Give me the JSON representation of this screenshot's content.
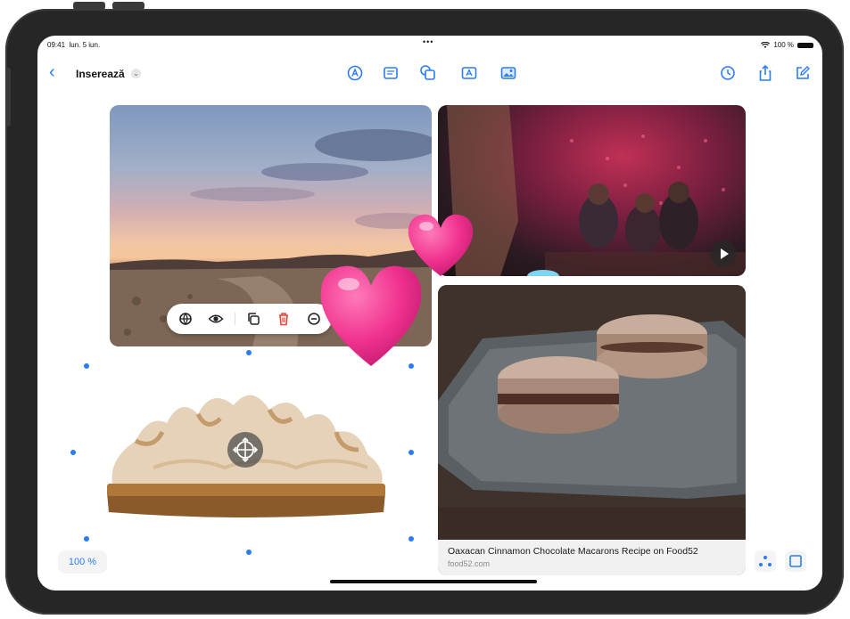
{
  "status_bar": {
    "time": "09:41",
    "date": "lun. 5 iun.",
    "dots": "•••",
    "battery_text": "100 %"
  },
  "toolbar": {
    "back_icon": "chevron-left-icon",
    "title": "Inserează",
    "title_menu_icon": "chevron-down-icon",
    "center_tools": [
      "pen-tool-icon",
      "sticky-note-icon",
      "shapes-icon",
      "text-box-icon",
      "media-icon"
    ],
    "right_tools": [
      "history-icon",
      "share-icon",
      "edit-icon"
    ],
    "accent_color": "#2b7cf2"
  },
  "canvas": {
    "photos": [
      {
        "name": "sunset-desert-photo"
      },
      {
        "name": "party-video-thumbnail",
        "play_icon": "play-icon"
      },
      {
        "name": "lemon-meringue-pie-cutout",
        "move_icon": "move-rotate-icon"
      }
    ],
    "stickers": [
      "heart-sticker-small",
      "heart-sticker-large"
    ],
    "context_menu": {
      "items": [
        "lookup-icon",
        "eye-icon",
        "duplicate-icon",
        "trash-icon",
        "more-icon"
      ],
      "delete_color": "#e5453a"
    },
    "link_card": {
      "title": "Oaxacan Cinnamon Chocolate Macarons Recipe on Food52",
      "domain": "food52.com"
    }
  },
  "bottom_bar": {
    "zoom": "100 %",
    "right_tools": [
      "connectors-icon",
      "frame-icon"
    ]
  }
}
